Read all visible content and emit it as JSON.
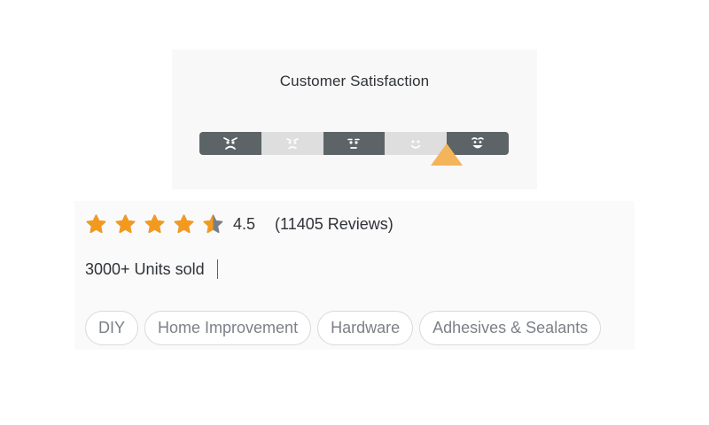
{
  "satisfaction": {
    "title": "Customer Satisfaction",
    "selected_level": 4,
    "pointer_color": "#f3b45a",
    "levels": [
      {
        "name": "very-dissatisfied",
        "icon": "angry-face-icon",
        "shade": "dark"
      },
      {
        "name": "dissatisfied",
        "icon": "sad-face-icon",
        "shade": "light"
      },
      {
        "name": "neutral",
        "icon": "neutral-face-icon",
        "shade": "dark"
      },
      {
        "name": "satisfied",
        "icon": "smile-face-icon",
        "shade": "light"
      },
      {
        "name": "very-satisfied",
        "icon": "grin-face-icon",
        "shade": "dark"
      }
    ]
  },
  "product": {
    "rating": {
      "value": "4.5",
      "stars_filled": 4.5,
      "stars_total": 5,
      "reviews_text": "(11405 Reviews)",
      "star_color": "#f39a1e",
      "empty_star_color": "#7a7f85"
    },
    "sold_text": "3000+ Units sold",
    "tags": [
      "DIY",
      "Home Improvement",
      "Hardware",
      "Adhesives & Sealants"
    ]
  }
}
